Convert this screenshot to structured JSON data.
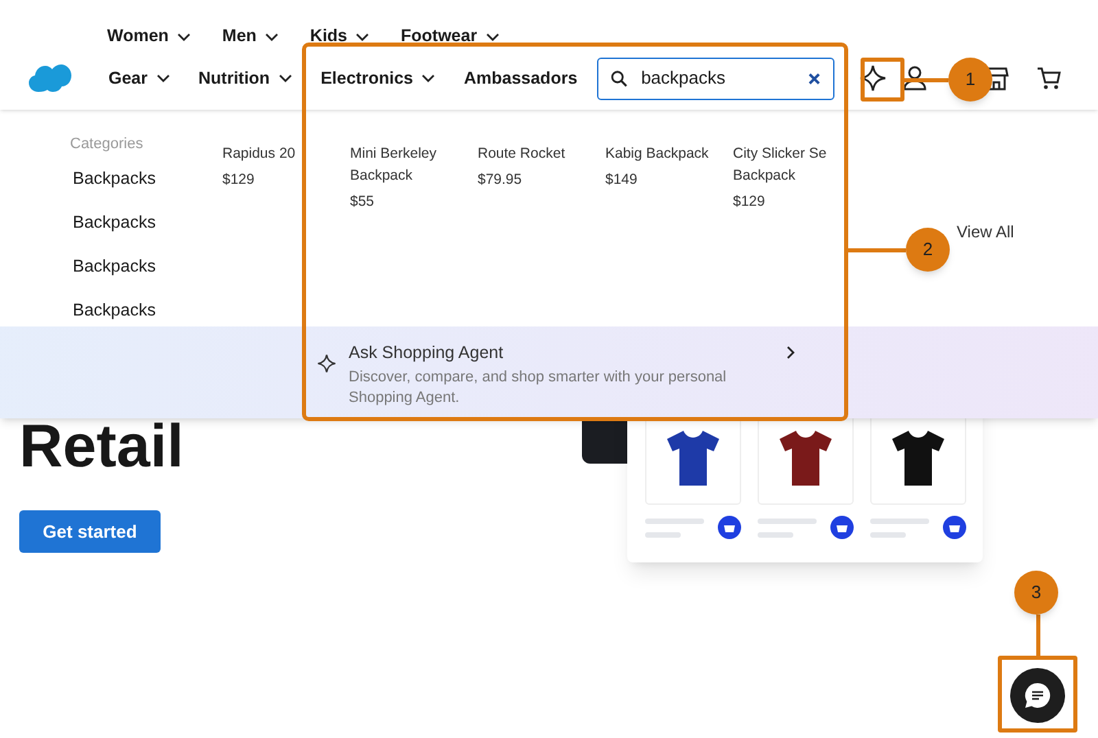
{
  "nav_row_1": [
    {
      "label": "Women"
    },
    {
      "label": "Men"
    },
    {
      "label": "Kids"
    },
    {
      "label": "Footwear"
    }
  ],
  "nav_row_2": [
    {
      "label": "Gear",
      "dropdown": true
    },
    {
      "label": "Nutrition",
      "dropdown": true
    },
    {
      "label": "Electronics",
      "dropdown": true
    },
    {
      "label": "Ambassadors",
      "dropdown": false
    }
  ],
  "search": {
    "value": "backpacks"
  },
  "hero": {
    "title": "Retail",
    "button": "Get started",
    "products": [
      {
        "color": "#1e3aa8"
      },
      {
        "color": "#7a1a1a"
      },
      {
        "color": "#111111"
      }
    ]
  },
  "suggestions": {
    "categories_label": "Categories",
    "categories": [
      "Backpacks",
      "Backpacks",
      "Backpacks",
      "Backpacks"
    ],
    "products": [
      {
        "name": "Rapidus 20",
        "price": "$129"
      },
      {
        "name": "Mini Berkeley Backpack",
        "price": "$55"
      },
      {
        "name": "Route Rocket",
        "price": "$79.95"
      },
      {
        "name": "Kabig Backpack",
        "price": "$149"
      },
      {
        "name": "City Slicker Se Backpack",
        "price": "$129"
      }
    ],
    "view_all": "View All",
    "agent": {
      "title": "Ask Shopping Agent",
      "description": "Discover, compare, and shop smarter with your personal Shopping Agent."
    }
  },
  "callouts": [
    {
      "number": "1"
    },
    {
      "number": "2"
    },
    {
      "number": "3"
    }
  ]
}
